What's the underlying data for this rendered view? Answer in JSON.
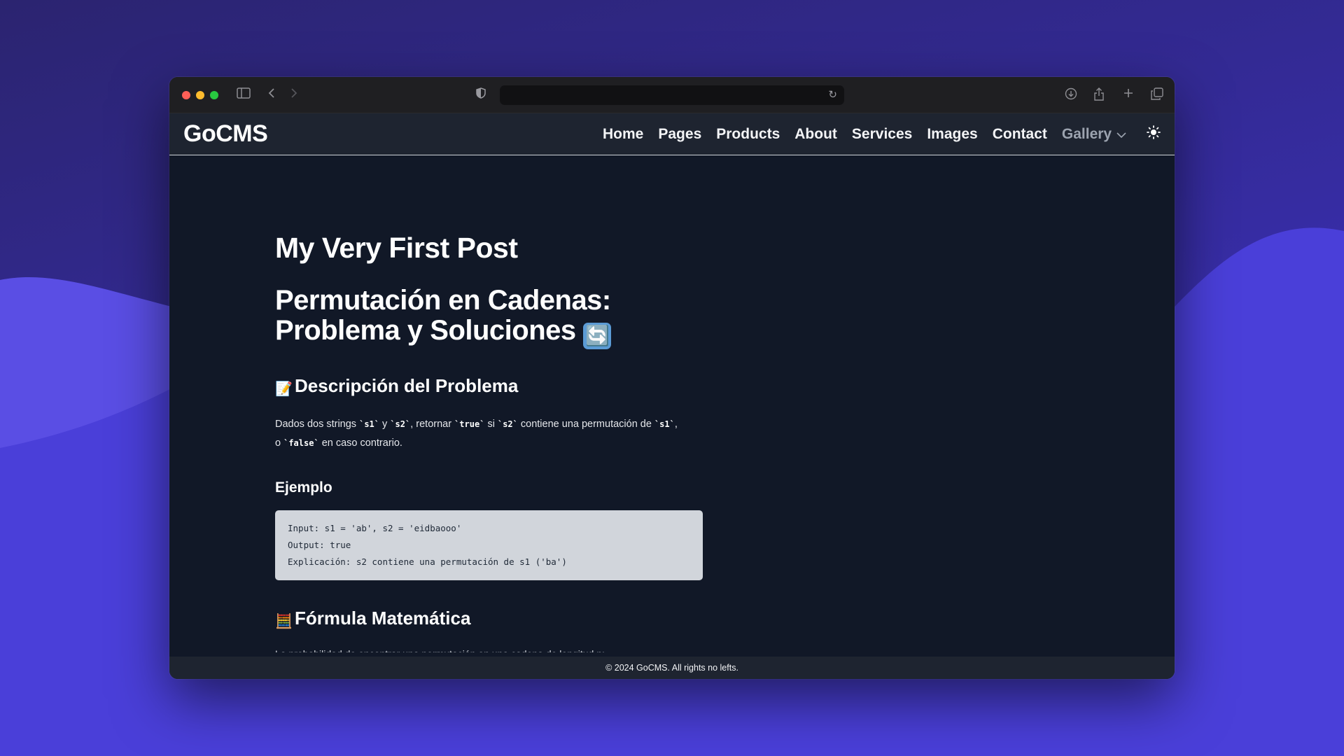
{
  "browser": {
    "traffic_lights": [
      "#ff5f57",
      "#febc2e",
      "#28c840"
    ],
    "icons": {
      "sidebar": "sidebar-icon",
      "back": "chevron-left-icon",
      "forward": "chevron-right-icon",
      "shield": "shield-icon",
      "reload": "reload-icon",
      "download": "download-icon",
      "share": "share-icon",
      "new_tab": "plus-icon",
      "tabs": "tabs-icon"
    },
    "url": ""
  },
  "navbar": {
    "brand": "GoCMS",
    "links": [
      "Home",
      "Pages",
      "Products",
      "About",
      "Services",
      "Images",
      "Contact"
    ],
    "gallery": "Gallery",
    "theme_icon": "sun-icon"
  },
  "post": {
    "title": "My Very First Post",
    "heading": "Permutación en Cadenas: Problema y Soluciones",
    "heading_emoji": "🔄",
    "section1": {
      "emoji": "📝",
      "title": "Descripción del Problema",
      "text_parts": [
        "Dados dos strings ",
        "`s1`",
        " y ",
        "`s2`",
        ", retornar ",
        "`true`",
        " si ",
        "`s2`",
        " contiene una permutación de ",
        "`s1`",
        ",",
        " o ",
        "`false`",
        " en caso contrario."
      ]
    },
    "example": {
      "title": "Ejemplo",
      "code_lines": [
        "Input: s1 = 'ab', s2 = 'eidbaooo'",
        "Output: true",
        "Explicación: s2 contiene una permutación de s1 ('ba')"
      ]
    },
    "section2": {
      "emoji": "🧮",
      "title": "Fórmula Matemática",
      "cut_text": "La probabilidad de encontrar una permutación en una cadena de longitud n:"
    }
  },
  "footer": {
    "text": "© 2024 GoCMS. All rights no lefts."
  }
}
